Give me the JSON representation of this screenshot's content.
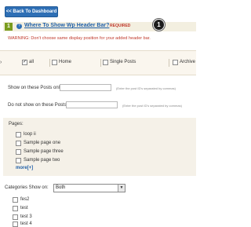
{
  "header": {
    "back_label": "<< Back To Dashboard"
  },
  "step": {
    "number": "1",
    "help_icon": "question-icon",
    "title": "Where To Show Wp Header Bar?",
    "required": "REQUIRED",
    "badge": "1"
  },
  "warning": "WARNING: Don't choose same display position for your added header bar.",
  "page_options": [
    {
      "label": "all",
      "checked": true
    },
    {
      "label": "Home",
      "checked": false
    },
    {
      "label": "Single Posts",
      "checked": false
    },
    {
      "label": "Archive",
      "checked": false
    }
  ],
  "show_on_posts": {
    "label": "Show on these Posts only:",
    "value": "",
    "hint": "(Enter the post ID's separated by commas)"
  },
  "do_not_show_posts": {
    "label": "Do not show on these Posts:",
    "value": "",
    "hint": "(Enter the post ID's separated by commas)"
  },
  "pages": {
    "title": "Pages:",
    "items": [
      {
        "label": "loop ii",
        "checked": false
      },
      {
        "label": "Sample page one",
        "checked": false
      },
      {
        "label": "Sample page three",
        "checked": false
      },
      {
        "label": "Sample page two",
        "checked": false
      }
    ],
    "more": "more[+]"
  },
  "categories": {
    "label": "Categories  Show on:",
    "selected": "Both",
    "items": [
      {
        "label": "fes2",
        "checked": false
      },
      {
        "label": "test",
        "checked": false
      },
      {
        "label": "test 3",
        "checked": false
      },
      {
        "label": "test 4",
        "checked": false
      }
    ]
  }
}
